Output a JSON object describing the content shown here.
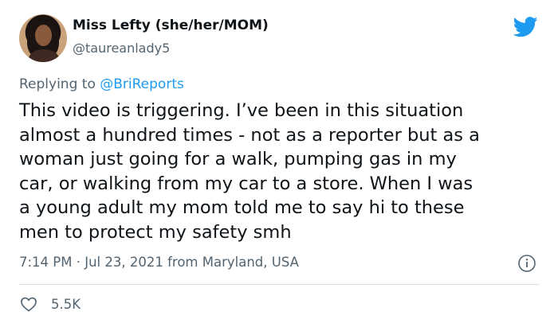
{
  "author": {
    "display_name": "Miss Lefty (she/her/MOM)",
    "handle": "@taureanlady5"
  },
  "reply": {
    "prefix": "Replying to ",
    "mention": "@BriReports"
  },
  "tweet": {
    "lines": [
      "This video is triggering. I’ve been in this situation",
      "almost a hundred times - not as a reporter but as a",
      "woman just going for a walk, pumping gas in my",
      "car, or walking from my car to a store. When I was",
      "a young adult my mom told me to say hi to these",
      "men to protect my safety smh"
    ]
  },
  "meta": {
    "timestamp": "7:14 PM · Jul 23, 2021 from Maryland, USA"
  },
  "stats": {
    "likes": "5.5K"
  },
  "icons": {
    "brand": "twitter-bird-icon",
    "info": "info-icon",
    "like": "heart-icon"
  },
  "colors": {
    "brand_blue": "#1d9bf0",
    "secondary_text": "#536471",
    "primary_text": "#0f1419"
  }
}
